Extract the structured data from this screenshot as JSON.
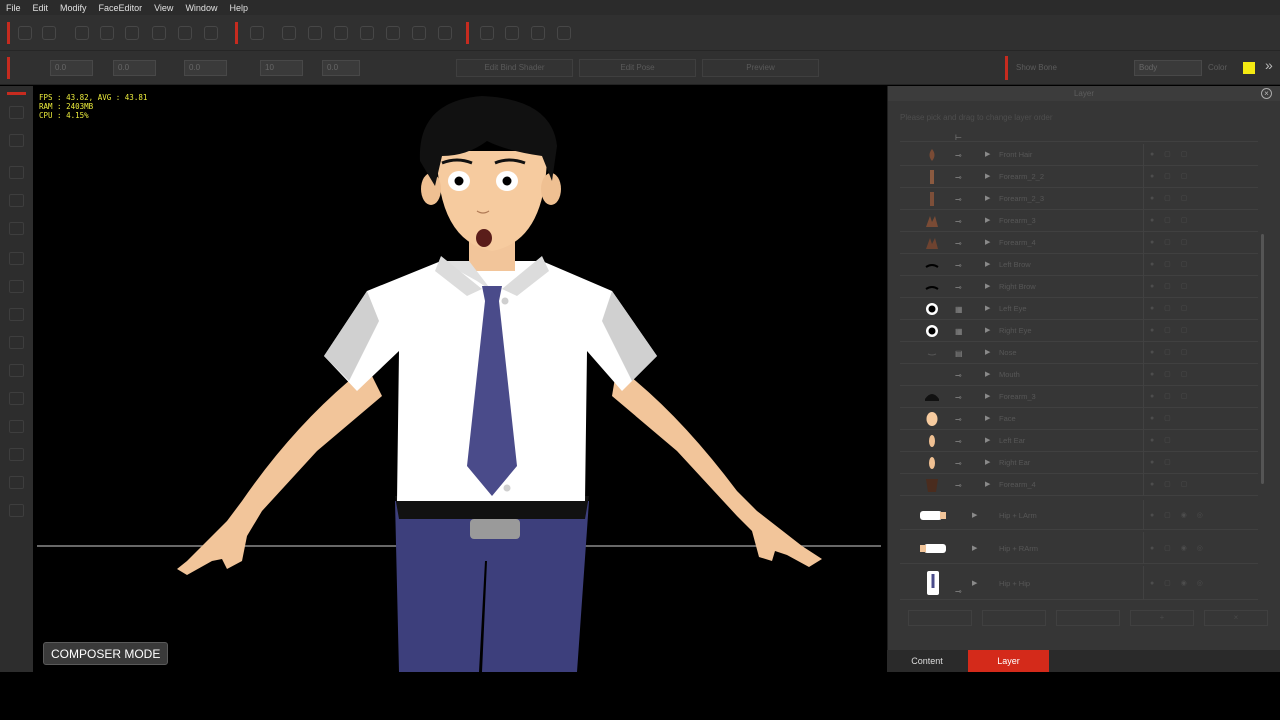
{
  "menu": [
    "File",
    "Edit",
    "Modify",
    "FaceEditor",
    "View",
    "Window",
    "Help"
  ],
  "toolbar": {
    "spin_values": [
      "0.0",
      "0.0",
      "0.0",
      "10",
      "0.0"
    ],
    "buttons": [
      "Edit Bind Shader",
      "Edit Pose",
      "Preview"
    ],
    "show_bone_label": "Show Bone",
    "dropdown_value": "Body",
    "color_label": "Color",
    "accent_color": "#f4ea12"
  },
  "viewport": {
    "hud": "FPS : 43.82, AVG : 43.81\nRAM : 2403MB\nCPU : 4.15%",
    "mode_label": "COMPOSER MODE"
  },
  "panel": {
    "title": "Layer",
    "hint": "Please pick and drag to change layer order",
    "layers": [
      {
        "name": "Front Hair",
        "thumb": "hair",
        "bone": "bone-icon"
      },
      {
        "name": "Forearm_2_2",
        "thumb": "arm",
        "bone": "bone-icon"
      },
      {
        "name": "Forearm_2_3",
        "thumb": "arm",
        "bone": "bone-icon"
      },
      {
        "name": "Forearm_3",
        "thumb": "hand",
        "bone": "bone-icon"
      },
      {
        "name": "Forearm_4",
        "thumb": "hand",
        "bone": "bone-icon"
      },
      {
        "name": "Left Brow",
        "thumb": "brow",
        "bone": "bone-icon"
      },
      {
        "name": "Right Brow",
        "thumb": "brow",
        "bone": "bone-icon"
      },
      {
        "name": "Left Eye",
        "thumb": "eye",
        "bone": "grid-icon"
      },
      {
        "name": "Right Eye",
        "thumb": "eye",
        "bone": "grid-icon"
      },
      {
        "name": "Nose",
        "thumb": "nose",
        "bone": "doc-icon"
      },
      {
        "name": "Mouth",
        "thumb": "none",
        "bone": "bone-icon"
      },
      {
        "name": "Forearm_3",
        "thumb": "hairback",
        "bone": "bone-icon"
      },
      {
        "name": "Face",
        "thumb": "face",
        "bone": "bone-icon"
      },
      {
        "name": "Left Ear",
        "thumb": "ear",
        "bone": "bone-icon"
      },
      {
        "name": "Right Ear",
        "thumb": "ear",
        "bone": "bone-icon"
      },
      {
        "name": "Forearm_4",
        "thumb": "neck",
        "bone": "bone-icon"
      }
    ],
    "groups": [
      {
        "name": "Hip + LArm",
        "thumb": "sleeve"
      },
      {
        "name": "Hip + RArm",
        "thumb": "sleeve"
      },
      {
        "name": "Hip + Hip",
        "thumb": "shirt"
      }
    ],
    "bottom_buttons": [
      "",
      "",
      "",
      "+",
      "×"
    ]
  },
  "tabs": {
    "content": "Content",
    "layer": "Layer"
  }
}
